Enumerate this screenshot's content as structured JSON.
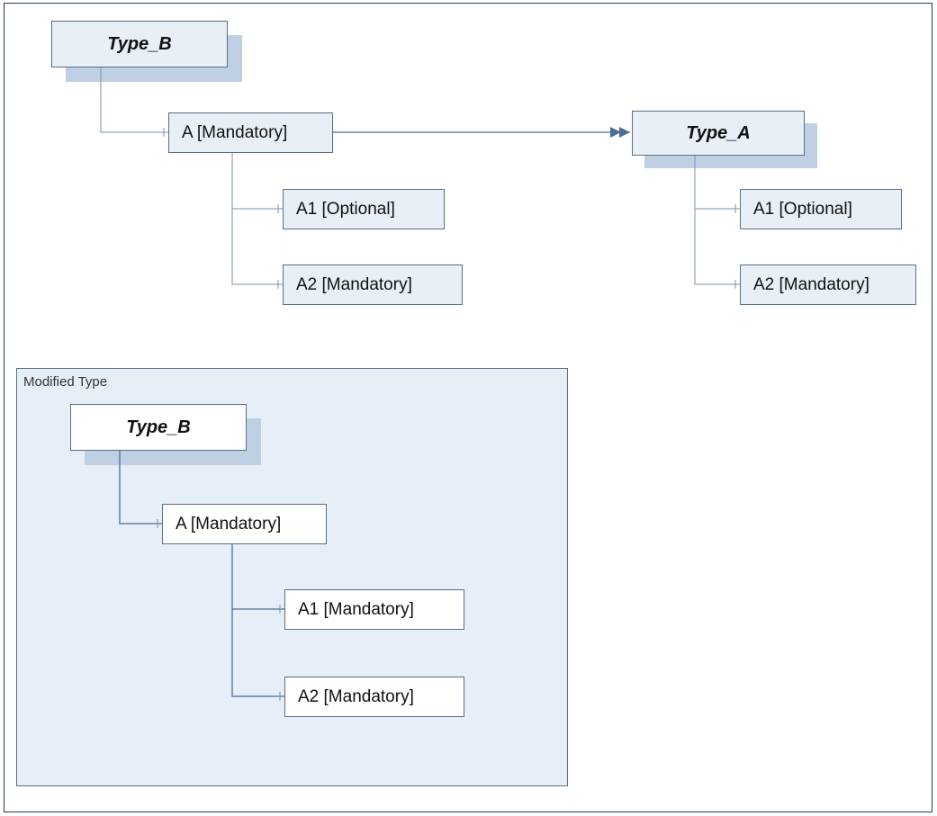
{
  "top": {
    "typeB": "Type_B",
    "a": "A [Mandatory]",
    "a1": "A1 [Optional]",
    "a2": "A2 [Mandatory]",
    "typeA": "Type_A",
    "ta1": "A1 [Optional]",
    "ta2": "A2 [Mandatory]"
  },
  "panel": {
    "title": "Modified Type",
    "typeB": "Type_B",
    "a": "A [Mandatory]",
    "a1": "A1 [Mandatory]",
    "a2": "A2 [Mandatory]"
  }
}
